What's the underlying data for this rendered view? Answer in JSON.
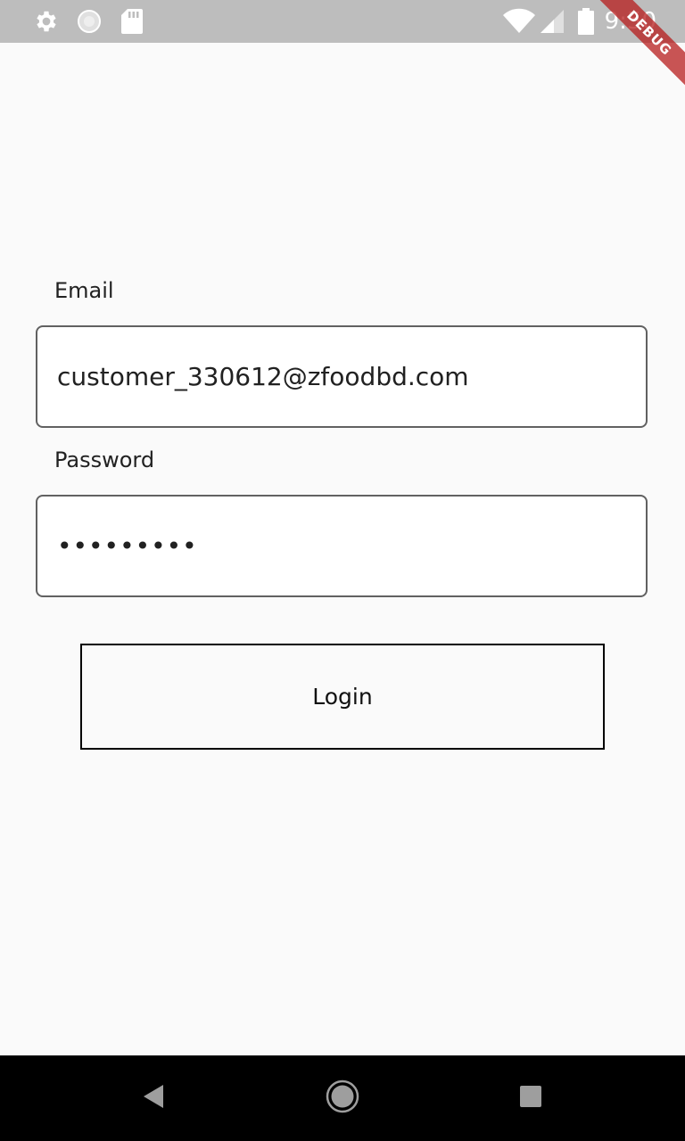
{
  "status_bar": {
    "time": "9:50",
    "icons": [
      "settings-icon",
      "loading-icon",
      "sd-card-icon",
      "wifi-icon",
      "signal-icon",
      "battery-icon"
    ]
  },
  "debug_banner": {
    "label": "DEBUG",
    "color": "#b71c1c"
  },
  "form": {
    "email": {
      "label": "Email",
      "value": "customer_330612@zfoodbd.com"
    },
    "password": {
      "label": "Password",
      "masked_value": "•••••••••"
    },
    "login_button": {
      "label": "Login"
    }
  },
  "nav_bar": {
    "buttons": [
      "back-icon",
      "home-icon",
      "recents-icon"
    ]
  }
}
